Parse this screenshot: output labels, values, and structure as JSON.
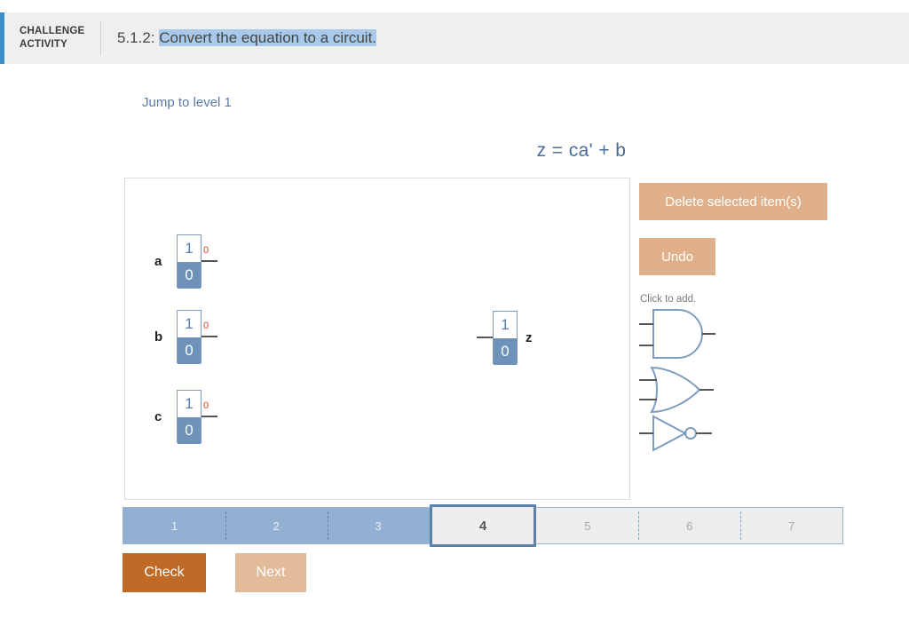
{
  "header": {
    "badge_line1": "CHALLENGE",
    "badge_line2": "ACTIVITY",
    "number": "5.1.2:",
    "title": "Convert the equation to a circuit.",
    "accent_color": "#3c8dcc",
    "highlight_color": "#a8c9ea"
  },
  "jump_link": "Jump to level 1",
  "equation": "z = ca' + b",
  "canvas": {
    "inputs": [
      {
        "label": "a",
        "high": "1",
        "low": "0",
        "value": "0"
      },
      {
        "label": "b",
        "high": "1",
        "low": "0",
        "value": "0"
      },
      {
        "label": "c",
        "high": "1",
        "low": "0",
        "value": "0"
      }
    ],
    "output": {
      "label": "z",
      "high": "1",
      "low": "0"
    }
  },
  "tools": {
    "delete_label": "Delete selected item(s)",
    "undo_label": "Undo",
    "palette_hint": "Click to add.",
    "button_color": "#dfb08a",
    "gates": [
      {
        "name": "and-gate",
        "type": "AND"
      },
      {
        "name": "or-gate",
        "type": "OR"
      },
      {
        "name": "not-gate",
        "type": "NOT"
      }
    ]
  },
  "progress": {
    "steps": [
      {
        "label": "1",
        "state": "done"
      },
      {
        "label": "2",
        "state": "done"
      },
      {
        "label": "3",
        "state": "done"
      },
      {
        "label": "4",
        "state": "current"
      },
      {
        "label": "5",
        "state": "todo"
      },
      {
        "label": "6",
        "state": "todo"
      },
      {
        "label": "7",
        "state": "todo"
      }
    ]
  },
  "actions": {
    "check_label": "Check",
    "next_label": "Next",
    "check_color": "#c06a28",
    "next_color": "#e2bb9b"
  }
}
